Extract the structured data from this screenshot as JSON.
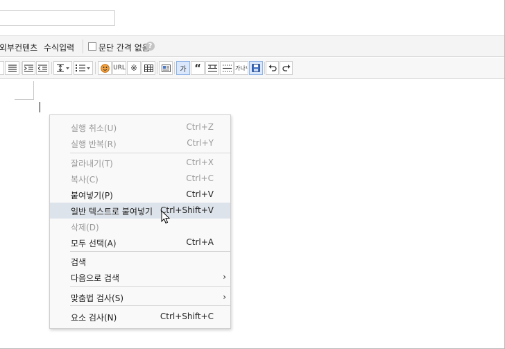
{
  "options": {
    "external_content": "외부컨텐츠",
    "formula_input": "수식입력",
    "no_paragraph_spacing": "문단 간격 없음",
    "help_glyph": "?"
  },
  "toolbar": {
    "link_label": "URL",
    "special_char": "※",
    "quote_glyph": "“",
    "font_sample": "가",
    "ruby_label": "가나¹"
  },
  "context_menu": {
    "items": [
      {
        "label": "실행 취소(U)",
        "shortcut": "Ctrl+Z",
        "enabled": false
      },
      {
        "label": "실행 반복(R)",
        "shortcut": "Ctrl+Y",
        "enabled": false
      },
      {
        "label": "잘라내기(T)",
        "shortcut": "Ctrl+X",
        "enabled": false
      },
      {
        "label": "복사(C)",
        "shortcut": "Ctrl+C",
        "enabled": false
      },
      {
        "label": "붙여넣기(P)",
        "shortcut": "Ctrl+V",
        "enabled": true
      },
      {
        "label": "일반 텍스트로 붙여넣기",
        "shortcut": "Ctrl+Shift+V",
        "enabled": true
      },
      {
        "label": "삭제(D)",
        "shortcut": "",
        "enabled": false
      },
      {
        "label": "모두 선택(A)",
        "shortcut": "Ctrl+A",
        "enabled": true
      },
      {
        "label": "검색",
        "shortcut": "",
        "enabled": true
      },
      {
        "label": "다음으로 검색",
        "shortcut": "",
        "enabled": true
      },
      {
        "label": "맞춤법 검사(S)",
        "shortcut": "",
        "enabled": true
      },
      {
        "label": "요소 검사(N)",
        "shortcut": "Ctrl+Shift+C",
        "enabled": true
      }
    ],
    "submenu_arrow": "›",
    "hovered_index": 5
  }
}
